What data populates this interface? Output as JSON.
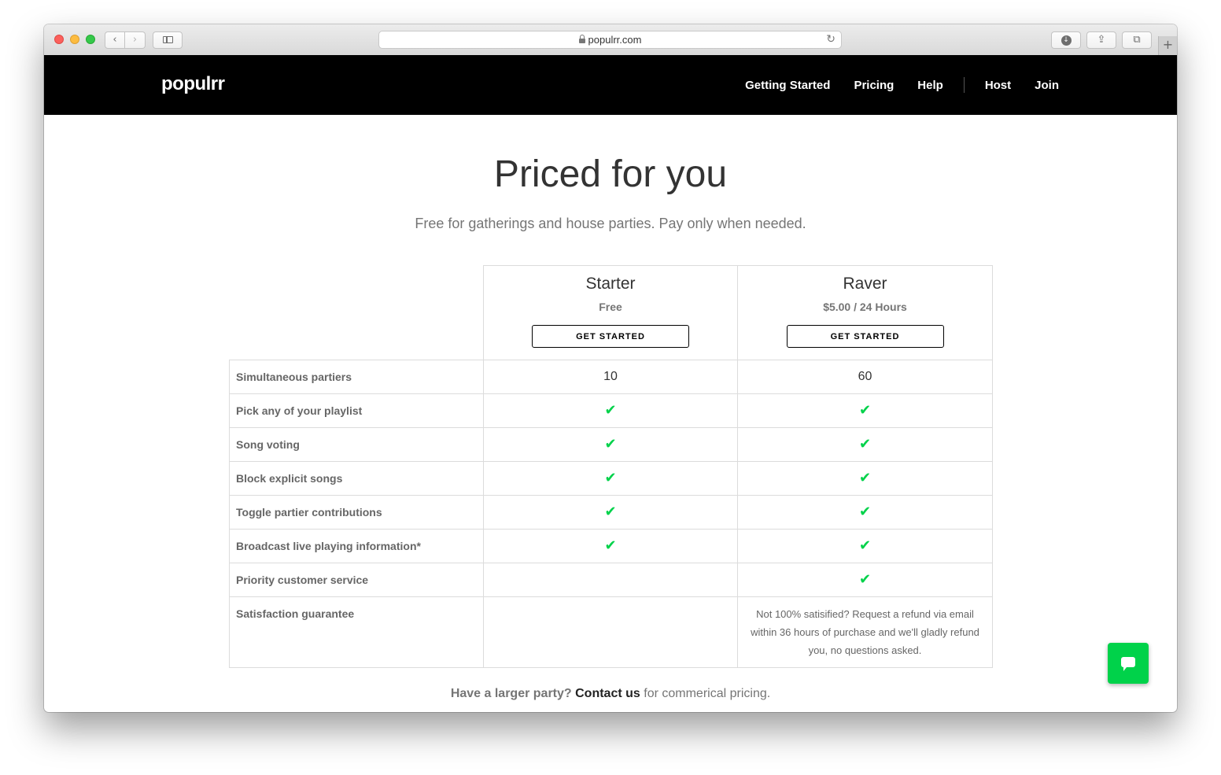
{
  "browser": {
    "url": "populrr.com",
    "back_glyph": "‹",
    "forward_glyph": "›",
    "reload_glyph": "↻",
    "share_glyph": "⇪",
    "tabs_glyph": "⧉",
    "download_glyph": "↓",
    "new_tab_glyph": "+"
  },
  "header": {
    "logo": "populrr",
    "nav": [
      "Getting Started",
      "Pricing",
      "Help",
      "Host",
      "Join"
    ]
  },
  "main": {
    "title": "Priced for you",
    "subtitle": "Free for gatherings and house parties. Pay only when needed."
  },
  "plans": [
    {
      "name": "Starter",
      "price": "Free",
      "cta": "GET STARTED"
    },
    {
      "name": "Raver",
      "price": "$5.00 / 24 Hours",
      "cta": "GET STARTED"
    }
  ],
  "features": [
    {
      "label": "Simultaneous partiers",
      "starter": "10",
      "raver": "60"
    },
    {
      "label": "Pick any of your playlist",
      "starter": "✔",
      "raver": "✔"
    },
    {
      "label": "Song voting",
      "starter": "✔",
      "raver": "✔"
    },
    {
      "label": "Block explicit songs",
      "starter": "✔",
      "raver": "✔"
    },
    {
      "label": "Toggle partier contributions",
      "starter": "✔",
      "raver": "✔"
    },
    {
      "label": "Broadcast live playing information*",
      "starter": "✔",
      "raver": "✔"
    },
    {
      "label": "Priority customer service",
      "starter": "",
      "raver": "✔"
    },
    {
      "label": "Satisfaction guarantee",
      "starter": "",
      "raver": "Not 100% satisified? Request a refund via email within 36 hours of purchase and we'll gladly refund you, no questions asked."
    }
  ],
  "footer": {
    "lead": "Have a larger party?",
    "link": "Contact us",
    "tail": "for commerical pricing."
  },
  "colors": {
    "accent_green": "#00d24a",
    "header_bg": "#000000"
  },
  "icons": {
    "check": "check-icon",
    "chat": "chat-icon",
    "lock": "lock-icon"
  }
}
